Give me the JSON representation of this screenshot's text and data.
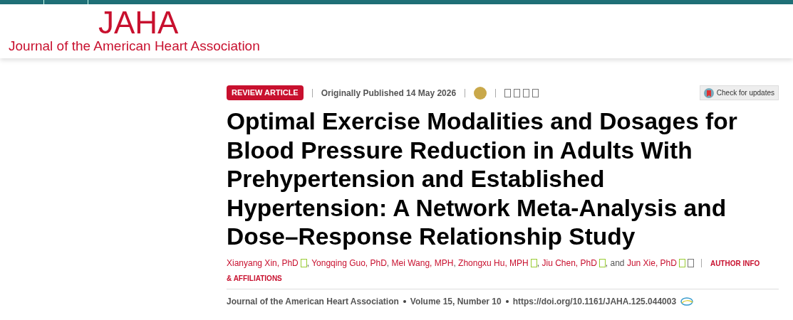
{
  "header": {
    "logo": "JAHA",
    "journal_name": "Journal of the American Heart Association"
  },
  "article_type": "REVIEW ARTICLE",
  "published": "Originally Published 14 May 2026",
  "check_updates": "Check for updates",
  "title": "Optimal Exercise Modalities and Dosages for Blood Pressure Reduction in Adults With Prehypertension and Established Hypertension: A Network Meta-Analysis and Dose–Response Relationship Study",
  "authors": [
    {
      "name": "Xianyang Xin, PhD",
      "orcid": true,
      "after": ", "
    },
    {
      "name": "Yongqing Guo, PhD",
      "orcid": false,
      "after": ", "
    },
    {
      "name": "Mei Wang, MPH",
      "orcid": false,
      "after": ", "
    },
    {
      "name": "Zhongxu Hu, MPH",
      "orcid": true,
      "after": ", "
    },
    {
      "name": "Jiu Chen, PhD",
      "orcid": true,
      "after": ", and "
    },
    {
      "name": "Jun Xie, PhD",
      "orcid": true,
      "email": true
    }
  ],
  "author_info": "AUTHOR INFO",
  "affiliations": "& AFFILIATIONS",
  "citation": {
    "journal": "Journal of the American Heart Association",
    "volume": "Volume 15, Number 10",
    "doi": "https://doi.org/10.1161/JAHA.125.044003"
  }
}
